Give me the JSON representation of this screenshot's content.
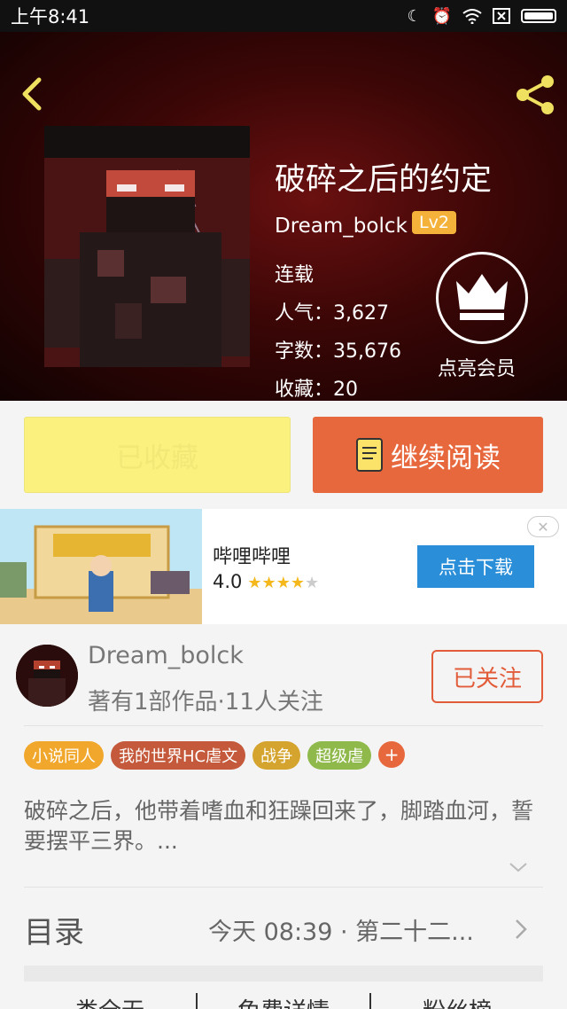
{
  "status_bar": {
    "time": "上午8:41",
    "icons": [
      "moon-icon",
      "alarm-icon",
      "wifi-icon",
      "sim-off-icon",
      "battery-icon"
    ]
  },
  "book": {
    "title": "破碎之后的约定",
    "author": "Dream_bolck",
    "level": "Lv2",
    "status": "连载",
    "popularity": "人气：3,627",
    "word_count": "字数：35,676",
    "favorites": "收藏：20",
    "vip_label": "点亮会员"
  },
  "actions": {
    "favorited_label": "已收藏",
    "continue_label": "继续阅读"
  },
  "ad": {
    "app_name": "哔哩哔哩",
    "rating": "4.0",
    "stars_filled": 4,
    "download_label": "点击下载",
    "close_symbol": "✕"
  },
  "author_info": {
    "name": "Dream_bolck",
    "stats": "著有1部作品·11人关注",
    "follow_label": "已关注"
  },
  "tags": [
    {
      "label": "小说同人",
      "color": "#f1a72b"
    },
    {
      "label": "我的世界HC虐文",
      "color": "#c4593b"
    },
    {
      "label": "战争",
      "color": "#d4a42e"
    },
    {
      "label": "超级虐",
      "color": "#8fb94a"
    }
  ],
  "tag_add_symbol": "+",
  "summary": "破碎之后，他带着嗜血和狂躁回来了，脚踏血河，誓要摆平三界。...",
  "toc": {
    "label": "目录",
    "latest": "今天 08:39 · 第二十二..."
  },
  "bottom_tabs": [
    "类全无",
    "免费详情",
    "粉丝榜"
  ],
  "colors": {
    "accent": "#e8683d",
    "fav_bg": "#fbf17e",
    "hero_bg": "#3a0606",
    "ad_button": "#2b8ed8"
  }
}
